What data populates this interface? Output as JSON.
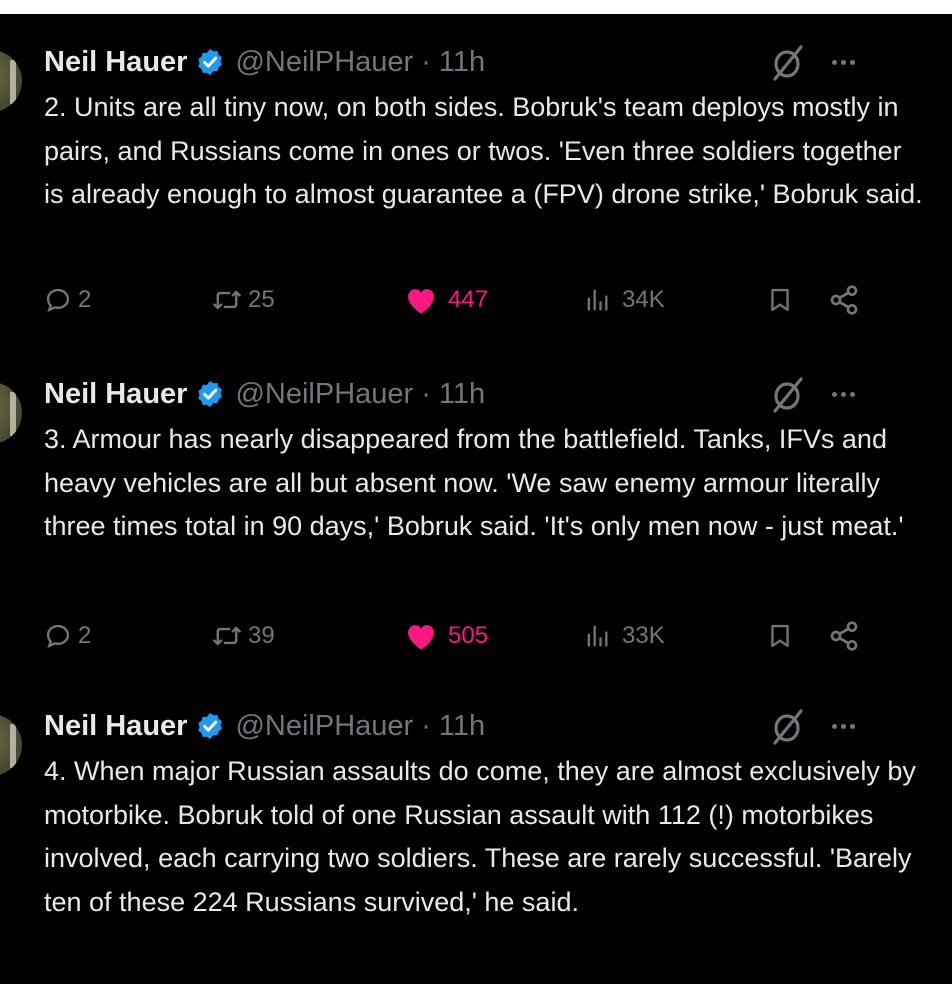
{
  "tweets": [
    {
      "author": "Neil Hauer",
      "handle": "@NeilPHauer",
      "time": "11h",
      "text": "2. Units are all tiny now, on both sides. Bobruk's team deploys mostly in pairs, and Russians come in ones or twos. 'Even three soldiers together is already enough to almost guarantee a (FPV) drone strike,' Bobruk said.",
      "replies": "2",
      "reposts": "25",
      "likes": "447",
      "views": "34K"
    },
    {
      "author": "Neil Hauer",
      "handle": "@NeilPHauer",
      "time": "11h",
      "text": "3. Armour has nearly disappeared from the battlefield. Tanks, IFVs and heavy vehicles are all but absent now. 'We saw enemy armour literally three times total in 90 days,' Bobruk said. 'It's only men now - just meat.'",
      "replies": "2",
      "reposts": "39",
      "likes": "505",
      "views": "33K"
    },
    {
      "author": "Neil Hauer",
      "handle": "@NeilPHauer",
      "time": "11h",
      "text": "4. When major Russian assaults do come, they are almost exclusively by motorbike. Bobruk told of one Russian assault with 112 (!) motorbikes involved, each carrying two soldiers. These are rarely successful. 'Barely ten of these 224 Russians survived,' he said."
    }
  ],
  "separator": "·",
  "icons": {
    "verified": "verified-badge-icon",
    "grok": "grok-icon",
    "more": "more-icon",
    "reply": "reply-icon",
    "repost": "repost-icon",
    "like": "heart-icon",
    "views": "views-icon",
    "bookmark": "bookmark-icon",
    "share": "share-icon"
  },
  "colors": {
    "background": "#000000",
    "text": "#e7e9ea",
    "muted": "#71767b",
    "like": "#f91880",
    "verified": "#1d9bf0"
  }
}
